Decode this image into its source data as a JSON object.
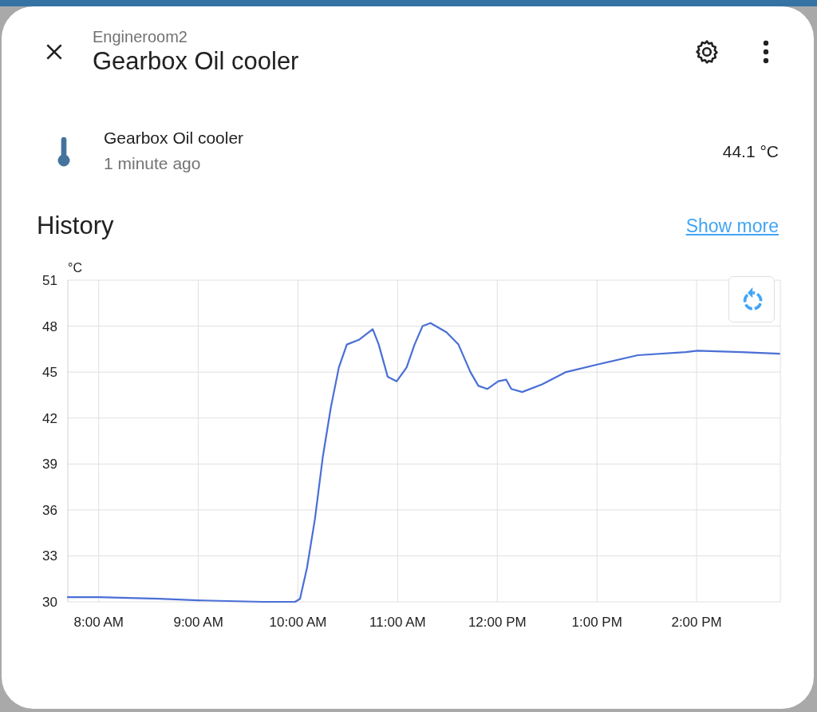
{
  "dialog": {
    "breadcrumb": "Engineroom2",
    "title": "Gearbox Oil cooler"
  },
  "entity": {
    "name": "Gearbox Oil cooler",
    "updated": "1 minute ago",
    "state": "44.1 °C"
  },
  "history": {
    "title": "History",
    "link": "Show more",
    "chart_data": {
      "type": "line",
      "ylabel": "°C",
      "grid": true,
      "xlim": [
        7.69,
        14.84
      ],
      "ylim": [
        30,
        51
      ],
      "xticks": [
        {
          "value": 8,
          "label": "8:00 AM"
        },
        {
          "value": 9,
          "label": "9:00 AM"
        },
        {
          "value": 10,
          "label": "10:00 AM"
        },
        {
          "value": 11,
          "label": "11:00 AM"
        },
        {
          "value": 12,
          "label": "12:00 PM"
        },
        {
          "value": 13,
          "label": "1:00 PM"
        },
        {
          "value": 14,
          "label": "2:00 PM"
        }
      ],
      "yticks": [
        30,
        33,
        36,
        39,
        42,
        45,
        48,
        51
      ],
      "x": [
        7.69,
        8.0,
        8.61,
        9.0,
        9.65,
        9.97,
        10.02,
        10.09,
        10.17,
        10.25,
        10.33,
        10.41,
        10.49,
        10.61,
        10.75,
        10.81,
        10.9,
        10.99,
        11.09,
        11.17,
        11.25,
        11.33,
        11.49,
        11.61,
        11.73,
        11.81,
        11.9,
        12.01,
        12.09,
        12.14,
        12.25,
        12.45,
        12.69,
        13.01,
        13.41,
        13.89,
        14.01,
        14.45,
        14.83
      ],
      "series": [
        {
          "color": "#4a6fd6",
          "values": [
            30.3,
            30.3,
            30.2,
            30.1,
            30.0,
            30.0,
            30.2,
            32.2,
            35.4,
            39.5,
            42.7,
            45.3,
            46.8,
            47.1,
            47.8,
            46.8,
            44.7,
            44.4,
            45.3,
            46.8,
            48.0,
            48.2,
            47.6,
            46.8,
            45.0,
            44.1,
            43.9,
            44.4,
            44.5,
            43.9,
            43.7,
            44.2,
            45.0,
            45.5,
            46.1,
            46.3,
            46.4,
            46.3,
            46.2
          ]
        }
      ]
    }
  }
}
